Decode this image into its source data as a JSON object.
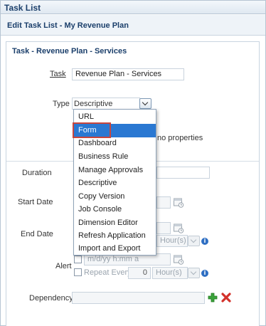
{
  "app": {
    "title": "Task List"
  },
  "page": {
    "title": "Edit Task List - My Revenue Plan"
  },
  "section": {
    "title": "Task - Revenue Plan - Services"
  },
  "form": {
    "task_label": "Task",
    "task_value": "Revenue Plan - Services",
    "type_label": "Type",
    "type_value": "Descriptive",
    "properties_hint": "no properties",
    "duration_label": "Duration",
    "start_date_label": "Start Date",
    "end_date_label": "End Date",
    "end_unit": "Hour(s)",
    "alert_label": "Alert",
    "alert_date_placeholder": "m/d/yy h:mm a",
    "alert_unit": "Hour(s)",
    "repeat_every_label": "Repeat Every",
    "repeat_every_value": "0",
    "repeat_unit": "Hour(s)",
    "dependency_label": "Dependency"
  },
  "type_options": [
    "URL",
    "Form",
    "Dashboard",
    "Business Rule",
    "Manage Approvals",
    "Descriptive",
    "Copy Version",
    "Job Console",
    "Dimension Editor",
    "Refresh Application",
    "Import and Export"
  ],
  "selected_option": "Form",
  "colors": {
    "accent": "#2a78d2",
    "highlight_box": "#c8463d",
    "title_text": "#1b3f6b"
  },
  "icons": {
    "type_dropdown": "chevron-down-icon",
    "calendar": "calendar-icon",
    "info": "info-icon",
    "add": "plus-icon",
    "remove": "x-icon"
  }
}
